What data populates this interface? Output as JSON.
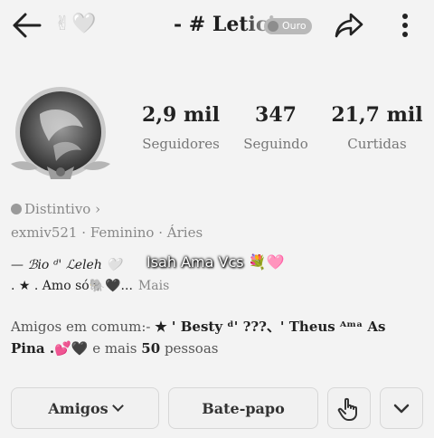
{
  "header": {
    "deco_emojis": "✌🤍",
    "title": "- # Letici",
    "badge": "Ouro"
  },
  "stats": [
    {
      "value": "2,9 mil",
      "label": "Seguidores"
    },
    {
      "value": "347",
      "label": "Seguindo"
    },
    {
      "value": "21,7 mil",
      "label": "Curtidas"
    }
  ],
  "profile": {
    "distinctive": "Distintivo ›",
    "username": "exmiv521",
    "gender": "Feminino",
    "sign": "Áries",
    "separator": "·",
    "bio_line1": "— ℬio ᵈ' ℒeleh 🤍",
    "bio_line2": ". ★ . Amo só🐘🖤...",
    "more": "Mais"
  },
  "caption": {
    "text": "Isah Ama Vcs",
    "emoji": "💐🩷"
  },
  "friends": {
    "line1_prefix": "Amigos em comum:-",
    "line1_names": "★ ' Besty ᵈ' ???、' Theus ᴬᵐᵃ As",
    "line2_names": "Pina .💕🖤",
    "line2_suffix": "e mais",
    "line2_count": "50",
    "line2_tail": "pessoas"
  },
  "actions": {
    "friends_label": "Amigos",
    "chat_label": "Bate-papo"
  },
  "colors": {
    "background": "#f3f3f3",
    "text": "#222222",
    "muted": "#888888",
    "badge": "#b9b9b9"
  },
  "icons": [
    "back-arrow-icon",
    "share-icon",
    "more-vertical-icon",
    "shield-dot-icon",
    "chevron-down-icon",
    "hand-pointer-icon"
  ]
}
